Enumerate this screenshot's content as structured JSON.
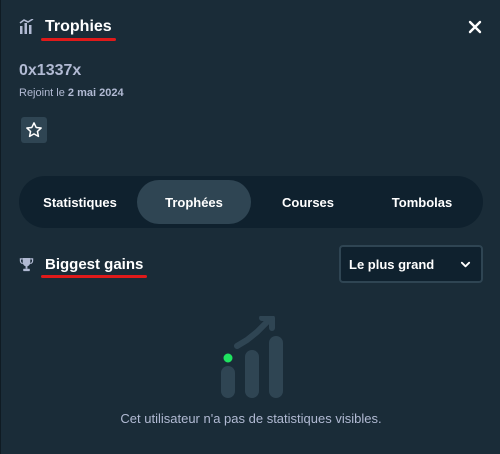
{
  "modal": {
    "title": "Trophies",
    "username": "0x1337x",
    "joined_prefix": "Rejoint le",
    "joined_date": "2 mai 2024"
  },
  "tabs": [
    {
      "label": "Statistiques",
      "active": false
    },
    {
      "label": "Trophées",
      "active": true
    },
    {
      "label": "Courses",
      "active": false
    },
    {
      "label": "Tombolas",
      "active": false
    }
  ],
  "section": {
    "title": "Biggest gains"
  },
  "sort_select": {
    "value": "Le plus grand"
  },
  "empty_state": {
    "message": "Cet utilisateur n'a pas de statistiques visibles."
  },
  "icons": {
    "header": "bar-chart-icon",
    "close": "close-icon",
    "favorite": "star-icon",
    "section": "trophy-icon",
    "select_caret": "chevron-down-icon",
    "empty": "stats-empty-icon"
  },
  "colors": {
    "background": "#1a2c38",
    "tab_bar": "#0f212e",
    "active_tab": "#2f4553",
    "muted_text": "#b1bad3",
    "highlight_underline": "#e01a1a",
    "accent_green": "#1fe360"
  }
}
